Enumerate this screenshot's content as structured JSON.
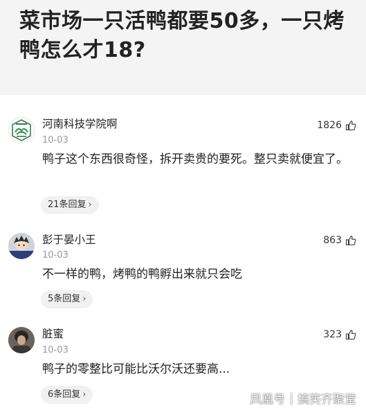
{
  "question": {
    "title": "菜市场一只活鸭都要50多，一只烤鸭怎么才18?"
  },
  "comments": [
    {
      "username": "河南科技学院啊",
      "date": "10-03",
      "likes": "1826",
      "text": "鸭子这个东西很奇怪，拆开卖贵的要死。整只卖就便宜了。",
      "replies": "21条回复",
      "avatar_icon": "university-emblem-icon"
    },
    {
      "username": "彭于晏小王",
      "date": "10-03",
      "likes": "863",
      "text": "不一样的鸭，烤鸭的鸭孵出来就只会吃",
      "replies": "5条回复",
      "avatar_icon": "cartoon-avatar-icon"
    },
    {
      "username": "脏蜜",
      "date": "10-03",
      "likes": "323",
      "text": "鸭子的零整比可能比沃尔沃还要高...",
      "replies": "6条回复",
      "avatar_icon": "photo-avatar-icon"
    }
  ],
  "watermark": {
    "source": "凤凰号",
    "account": "搞笑齐聚堂"
  },
  "colors": {
    "header_bg": "#f4f4f4",
    "date": "#999999",
    "reply_pill": "#f1f1f1"
  }
}
